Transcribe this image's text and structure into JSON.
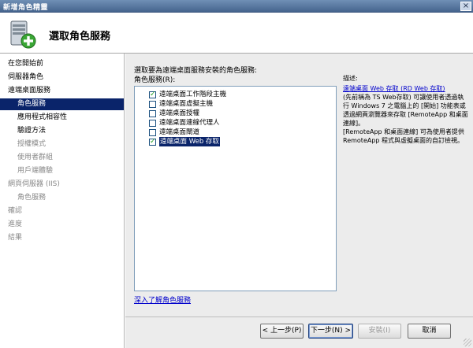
{
  "window": {
    "title": "新增角色精靈",
    "close_glyph": "×"
  },
  "header": {
    "title": "選取角色服務",
    "icon": "server-add-icon"
  },
  "sidebar": {
    "items": [
      {
        "label": "在您開始前",
        "level": 0,
        "state": "normal"
      },
      {
        "label": "伺服器角色",
        "level": 0,
        "state": "normal"
      },
      {
        "label": "遠端桌面服務",
        "level": 0,
        "state": "normal"
      },
      {
        "label": "角色服務",
        "level": 1,
        "state": "selected"
      },
      {
        "label": "應用程式相容性",
        "level": 1,
        "state": "normal"
      },
      {
        "label": "驗證方法",
        "level": 1,
        "state": "normal"
      },
      {
        "label": "授權模式",
        "level": 1,
        "state": "disabled"
      },
      {
        "label": "使用者群組",
        "level": 1,
        "state": "disabled"
      },
      {
        "label": "用戶端體驗",
        "level": 1,
        "state": "disabled"
      },
      {
        "label": "網頁伺服器 (IIS)",
        "level": 0,
        "state": "disabled"
      },
      {
        "label": "角色服務",
        "level": 1,
        "state": "disabled"
      },
      {
        "label": "確認",
        "level": 0,
        "state": "disabled"
      },
      {
        "label": "進度",
        "level": 0,
        "state": "disabled"
      },
      {
        "label": "結果",
        "level": 0,
        "state": "disabled"
      }
    ]
  },
  "main": {
    "instruction": "選取要為遠端桌面服務安裝的角色服務:",
    "services_label": "角色服務(R):",
    "services": [
      {
        "label": "遠端桌面工作階段主機",
        "checked": true,
        "highlighted": false
      },
      {
        "label": "遠端桌面虛擬主機",
        "checked": false,
        "highlighted": false
      },
      {
        "label": "遠端桌面授權",
        "checked": false,
        "highlighted": false
      },
      {
        "label": "遠端桌面連線代理人",
        "checked": false,
        "highlighted": false
      },
      {
        "label": "遠端桌面閘道",
        "checked": false,
        "highlighted": false
      },
      {
        "label": "遠端桌面 Web 存取",
        "checked": true,
        "highlighted": true
      }
    ],
    "more_link": "深入了解角色服務",
    "description": {
      "title": "描述:",
      "link": "遠端桌面 Web 存取 (RD Web 存取)",
      "body1": "(先前稱為 TS Web存取) 可讓使用者透過執行 Windows 7 之電腦上的 [開始] 功能表或透過網頁瀏覽器來存取 [RemoteApp 和桌面連線]。",
      "body2": "[RemoteApp 和桌面連線] 可為使用者提供 RemoteApp 程式與虛擬桌面的自訂檢視。"
    }
  },
  "footer": {
    "back": "< 上一步(P)",
    "next": "下一步(N) >",
    "install": "安裝(I)",
    "cancel": "取消"
  }
}
